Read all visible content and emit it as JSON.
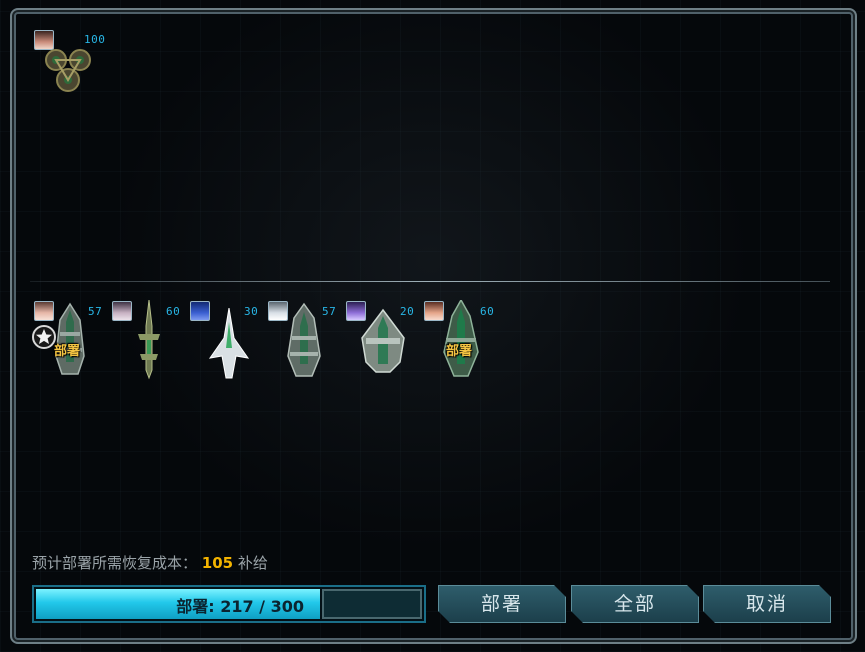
{
  "fleet_top": {
    "level": "100",
    "avatar_color": "#c98b7a"
  },
  "fleet_units": [
    {
      "level": "57",
      "deploy_label": "部署",
      "avatar_color": "#e7b7a8"
    },
    {
      "level": "60",
      "deploy_label": "",
      "avatar_color": "#c7b1c2"
    },
    {
      "level": "30",
      "deploy_label": "",
      "avatar_color": "#3a5fd1"
    },
    {
      "level": "57",
      "deploy_label": "",
      "avatar_color": "#d8dfe6"
    },
    {
      "level": "20",
      "deploy_label": "",
      "avatar_color": "#8f6fd8"
    },
    {
      "level": "60",
      "deploy_label": "部署",
      "avatar_color": "#e5a589"
    }
  ],
  "cost": {
    "label": "预计部署所需恢复成本：",
    "value": "105",
    "unit": "补给"
  },
  "deploy_meter": {
    "label": "部署: 217 / 300",
    "current": 217,
    "max": 300
  },
  "buttons": {
    "deploy": "部署",
    "all": "全部",
    "cancel": "取消"
  },
  "colors": {
    "level_text": "#28b6e6",
    "deploy_tag": "#f5c542",
    "cost_value": "#f4b400",
    "meter_fill": "#22c8ea"
  }
}
